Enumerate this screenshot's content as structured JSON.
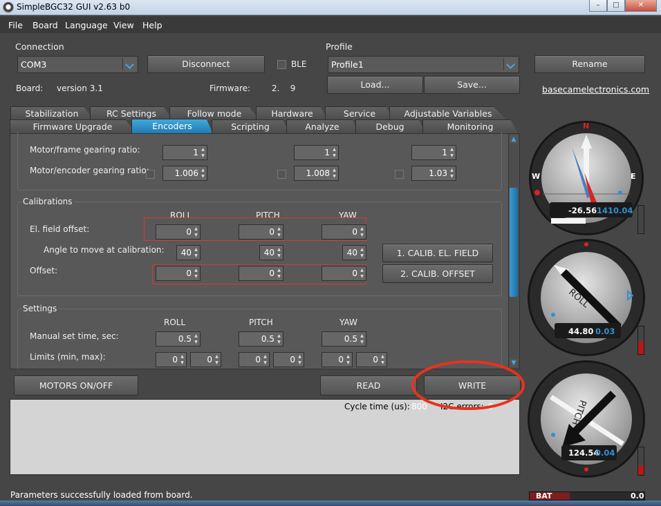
{
  "window": {
    "title": "SimpleBGC32 GUI v2.63 b0",
    "min": "–",
    "max": "□",
    "close": "✕"
  },
  "menu": [
    "File",
    "Board",
    "Language",
    "View",
    "Help"
  ],
  "connection": {
    "section_label": "Connection",
    "port": "COM3",
    "disconnect": "Disconnect",
    "ble_label": "BLE",
    "board_label": "Board:",
    "board_version": "version 3.1",
    "firmware_label": "Firmware:",
    "firmware_value": "2.    9"
  },
  "profile": {
    "section_label": "Profile",
    "name": "Profile1",
    "rename": "Rename",
    "load": "Load...",
    "save": "Save...",
    "website": "basecamelectronics.com"
  },
  "tabs_back": [
    "Stabilization",
    "RC Settings",
    "Follow mode",
    "Hardware",
    "Service",
    "Adjustable Variables"
  ],
  "tabs_front": [
    "Firmware Upgrade",
    "Encoders",
    "Scripting",
    "Analyze",
    "Debug",
    "Monitoring"
  ],
  "active_tab": "Encoders",
  "gearing": {
    "motor_frame_label": "Motor/frame gearing ratio:",
    "motor_encoder_label": "Motor/encoder gearing ratio:",
    "motor_frame": [
      "1",
      "1",
      "1"
    ],
    "motor_encoder": [
      "1.006",
      "1.008",
      "1.03"
    ]
  },
  "calibrations": {
    "title": "Calibrations",
    "columns": [
      "ROLL",
      "PITCH",
      "YAW"
    ],
    "el_field_label": "El. field offset:",
    "el_field": [
      "0",
      "0",
      "0"
    ],
    "angle_label": "Angle to move at calibration:",
    "angle": [
      "40",
      "40",
      "40"
    ],
    "offset_label": "Offset:",
    "offset": [
      "0",
      "0",
      "0"
    ],
    "btn_el_field": "1. CALIB. EL. FIELD",
    "btn_offset": "2. CALIB. OFFSET"
  },
  "settings": {
    "title": "Settings",
    "columns": [
      "ROLL",
      "PITCH",
      "YAW"
    ],
    "manual_label": "Manual set time, sec:",
    "manual": [
      "0.5",
      "0.5",
      "0.5"
    ],
    "limits_label": "Limits (min, max):",
    "limits": [
      "0",
      "0",
      "0",
      "0",
      "0",
      "0"
    ]
  },
  "actions": {
    "motors": "MOTORS ON/OFF",
    "read": "READ",
    "write": "WRITE"
  },
  "stats": {
    "cycle_label": "Cycle time (us):",
    "cycle_value": "800",
    "i2c_label": "I2C errors:",
    "i2c_value": "0"
  },
  "status_bar": "Parameters successfully loaded from board.",
  "compass": {
    "n": "N",
    "e": "E",
    "w": "W",
    "heading": "-26.56",
    "value2": "1410.04"
  },
  "roll_dial": {
    "label": "ROLL",
    "value": "44.80",
    "value2": "0.03"
  },
  "pitch_dial": {
    "label": "PITCH",
    "value": "124.54",
    "value2": "0.04"
  },
  "battery": {
    "label": "BAT",
    "value": "0.0"
  },
  "colors": {
    "accent": "#2f91cf",
    "highlight": "#d83b2e",
    "annotation": "#e8321e"
  }
}
